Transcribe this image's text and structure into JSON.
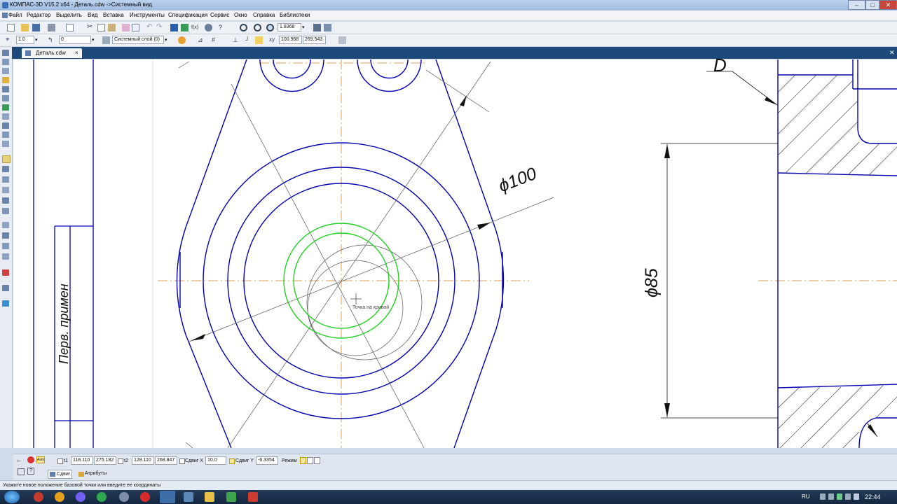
{
  "window": {
    "title": "КОМПАС-3D V15.2  x64 - Деталь.cdw ->Системный вид",
    "minimize": "–",
    "maximize": "□",
    "close": "✕"
  },
  "menu": [
    "Файл",
    "Редактор",
    "Выделить",
    "Вид",
    "Вставка",
    "Инструменты",
    "Спецификация",
    "Сервис",
    "Окно",
    "Справка",
    "Библиотеки"
  ],
  "toolbar1": {
    "zoom": "1.8368"
  },
  "toolbar2": {
    "scale": "1.0",
    "step": "0",
    "layer": "Системный слой (0)",
    "coord_x": "100.968",
    "coord_y": "269.543"
  },
  "document": {
    "tab": "Деталь.cdw"
  },
  "drawing": {
    "dim_100": "ϕ100",
    "dim_85": "ϕ85",
    "letter": "D",
    "perv_primen": "Перв. примен",
    "cursor_hint": "Точка на кривой"
  },
  "props": {
    "t1_label": "t1",
    "t1_x": "118.110",
    "t1_y": "275.182",
    "t2_label": "t2",
    "t2_x": "128.110",
    "t2_y": "268.847",
    "shift_x_label": "Сдвиг X",
    "shift_x": "10.0",
    "shift_y_label": "Сдвиг Y",
    "shift_y": "-6.3354",
    "mode_label": "Режим",
    "auto": "Auto",
    "tab_shift": "Сдвиг",
    "tab_attributes": "Атрибуты"
  },
  "status": {
    "text": "Укажите новое положение базовой точки или введите ее координаты"
  },
  "taskbar": {
    "lang": "RU",
    "time": "22:44"
  },
  "colors": {
    "drawing_blue": "#0000b0",
    "green": "#22d022",
    "axis_orange": "#e0a050",
    "thin": "#555555"
  }
}
